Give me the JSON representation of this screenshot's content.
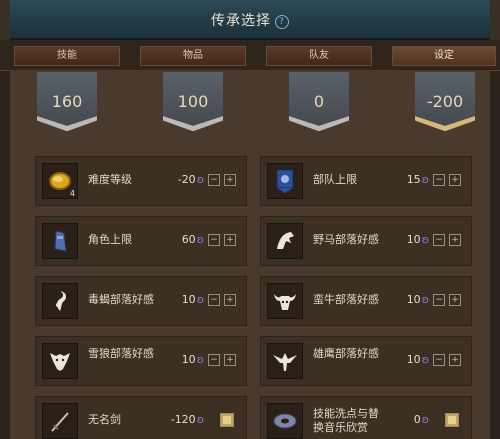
{
  "window": {
    "title": "传承选择",
    "help_icon": "question-circle-icon"
  },
  "tabs": [
    {
      "label": "技能",
      "active": false
    },
    {
      "label": "物品",
      "active": false
    },
    {
      "label": "队友",
      "active": false
    },
    {
      "label": "设定",
      "active": true
    }
  ],
  "points": [
    {
      "value": "160",
      "trim": "silver"
    },
    {
      "value": "100",
      "trim": "silver"
    },
    {
      "value": "0",
      "trim": "silver"
    },
    {
      "value": "-200",
      "trim": "gold"
    }
  ],
  "items": [
    {
      "name": "难度等级",
      "cost": "-20",
      "icon": "gold-coin-icon",
      "badge": "4",
      "control": "stepper"
    },
    {
      "name": "部队上限",
      "cost": "15",
      "icon": "banner-flag-icon",
      "control": "stepper"
    },
    {
      "name": "角色上限",
      "cost": "60",
      "icon": "blue-figure-icon",
      "control": "stepper"
    },
    {
      "name": "野马部落好感",
      "cost": "10",
      "icon": "horse-emblem-icon",
      "control": "stepper"
    },
    {
      "name": "毒蝎部落好感",
      "cost": "10",
      "icon": "scorpion-emblem-icon",
      "control": "stepper"
    },
    {
      "name": "蛮牛部落好感",
      "cost": "10",
      "icon": "bull-emblem-icon",
      "control": "stepper"
    },
    {
      "name": "雪狼部落好感",
      "cost": "10",
      "icon": "wolf-emblem-icon",
      "control": "stepper"
    },
    {
      "name": "雄鹰部落好感",
      "cost": "10",
      "icon": "eagle-emblem-icon",
      "control": "stepper"
    },
    {
      "name": "无名剑",
      "cost": "-120",
      "icon": "sword-icon",
      "control": "toggle"
    },
    {
      "name": "技能洗点与替换音乐欣赏",
      "cost": "0",
      "icon": "music-disc-icon",
      "control": "toggle"
    }
  ],
  "currency_symbol": "ʚ",
  "stepper": {
    "minus": "−",
    "plus": "+"
  }
}
